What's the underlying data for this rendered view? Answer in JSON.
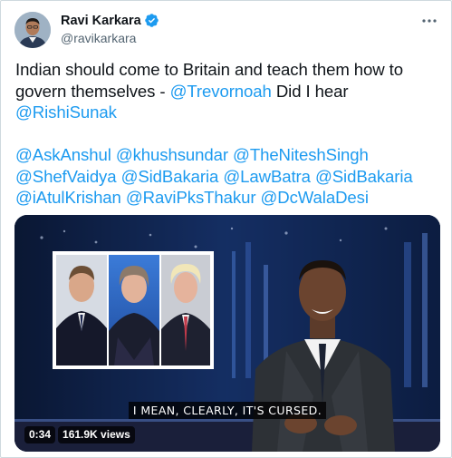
{
  "tweet": {
    "display_name": "Ravi Karkara",
    "handle": "@ravikarkara",
    "verified_icon": "verified-badge-icon",
    "more_icon": "more-options-icon",
    "text": {
      "line1_prefix": "Indian should come to Britain and teach them how to govern themselves - ",
      "mention_trevor": "@Trevornoah",
      "mid_text": " Did I hear",
      "mention_rishi": "@RishiSunak",
      "mentions": [
        "@AskAnshul",
        "@khushsundar",
        "@TheNiteshSingh",
        "@ShefVaidya",
        "@SidBakaria",
        "@LawBatra",
        "@SidBakaria",
        "@iAtulKrishan",
        "@RaviPksThakur",
        "@DcWalaDesi"
      ]
    },
    "video": {
      "caption": "I MEAN, CLEARLY, IT'S CURSED.",
      "time": "0:34",
      "views": "161.9K views"
    },
    "colors": {
      "link": "#1d9bf0",
      "verified": "#1d9bf0",
      "text": "#0f1419",
      "secondary": "#536471"
    }
  }
}
